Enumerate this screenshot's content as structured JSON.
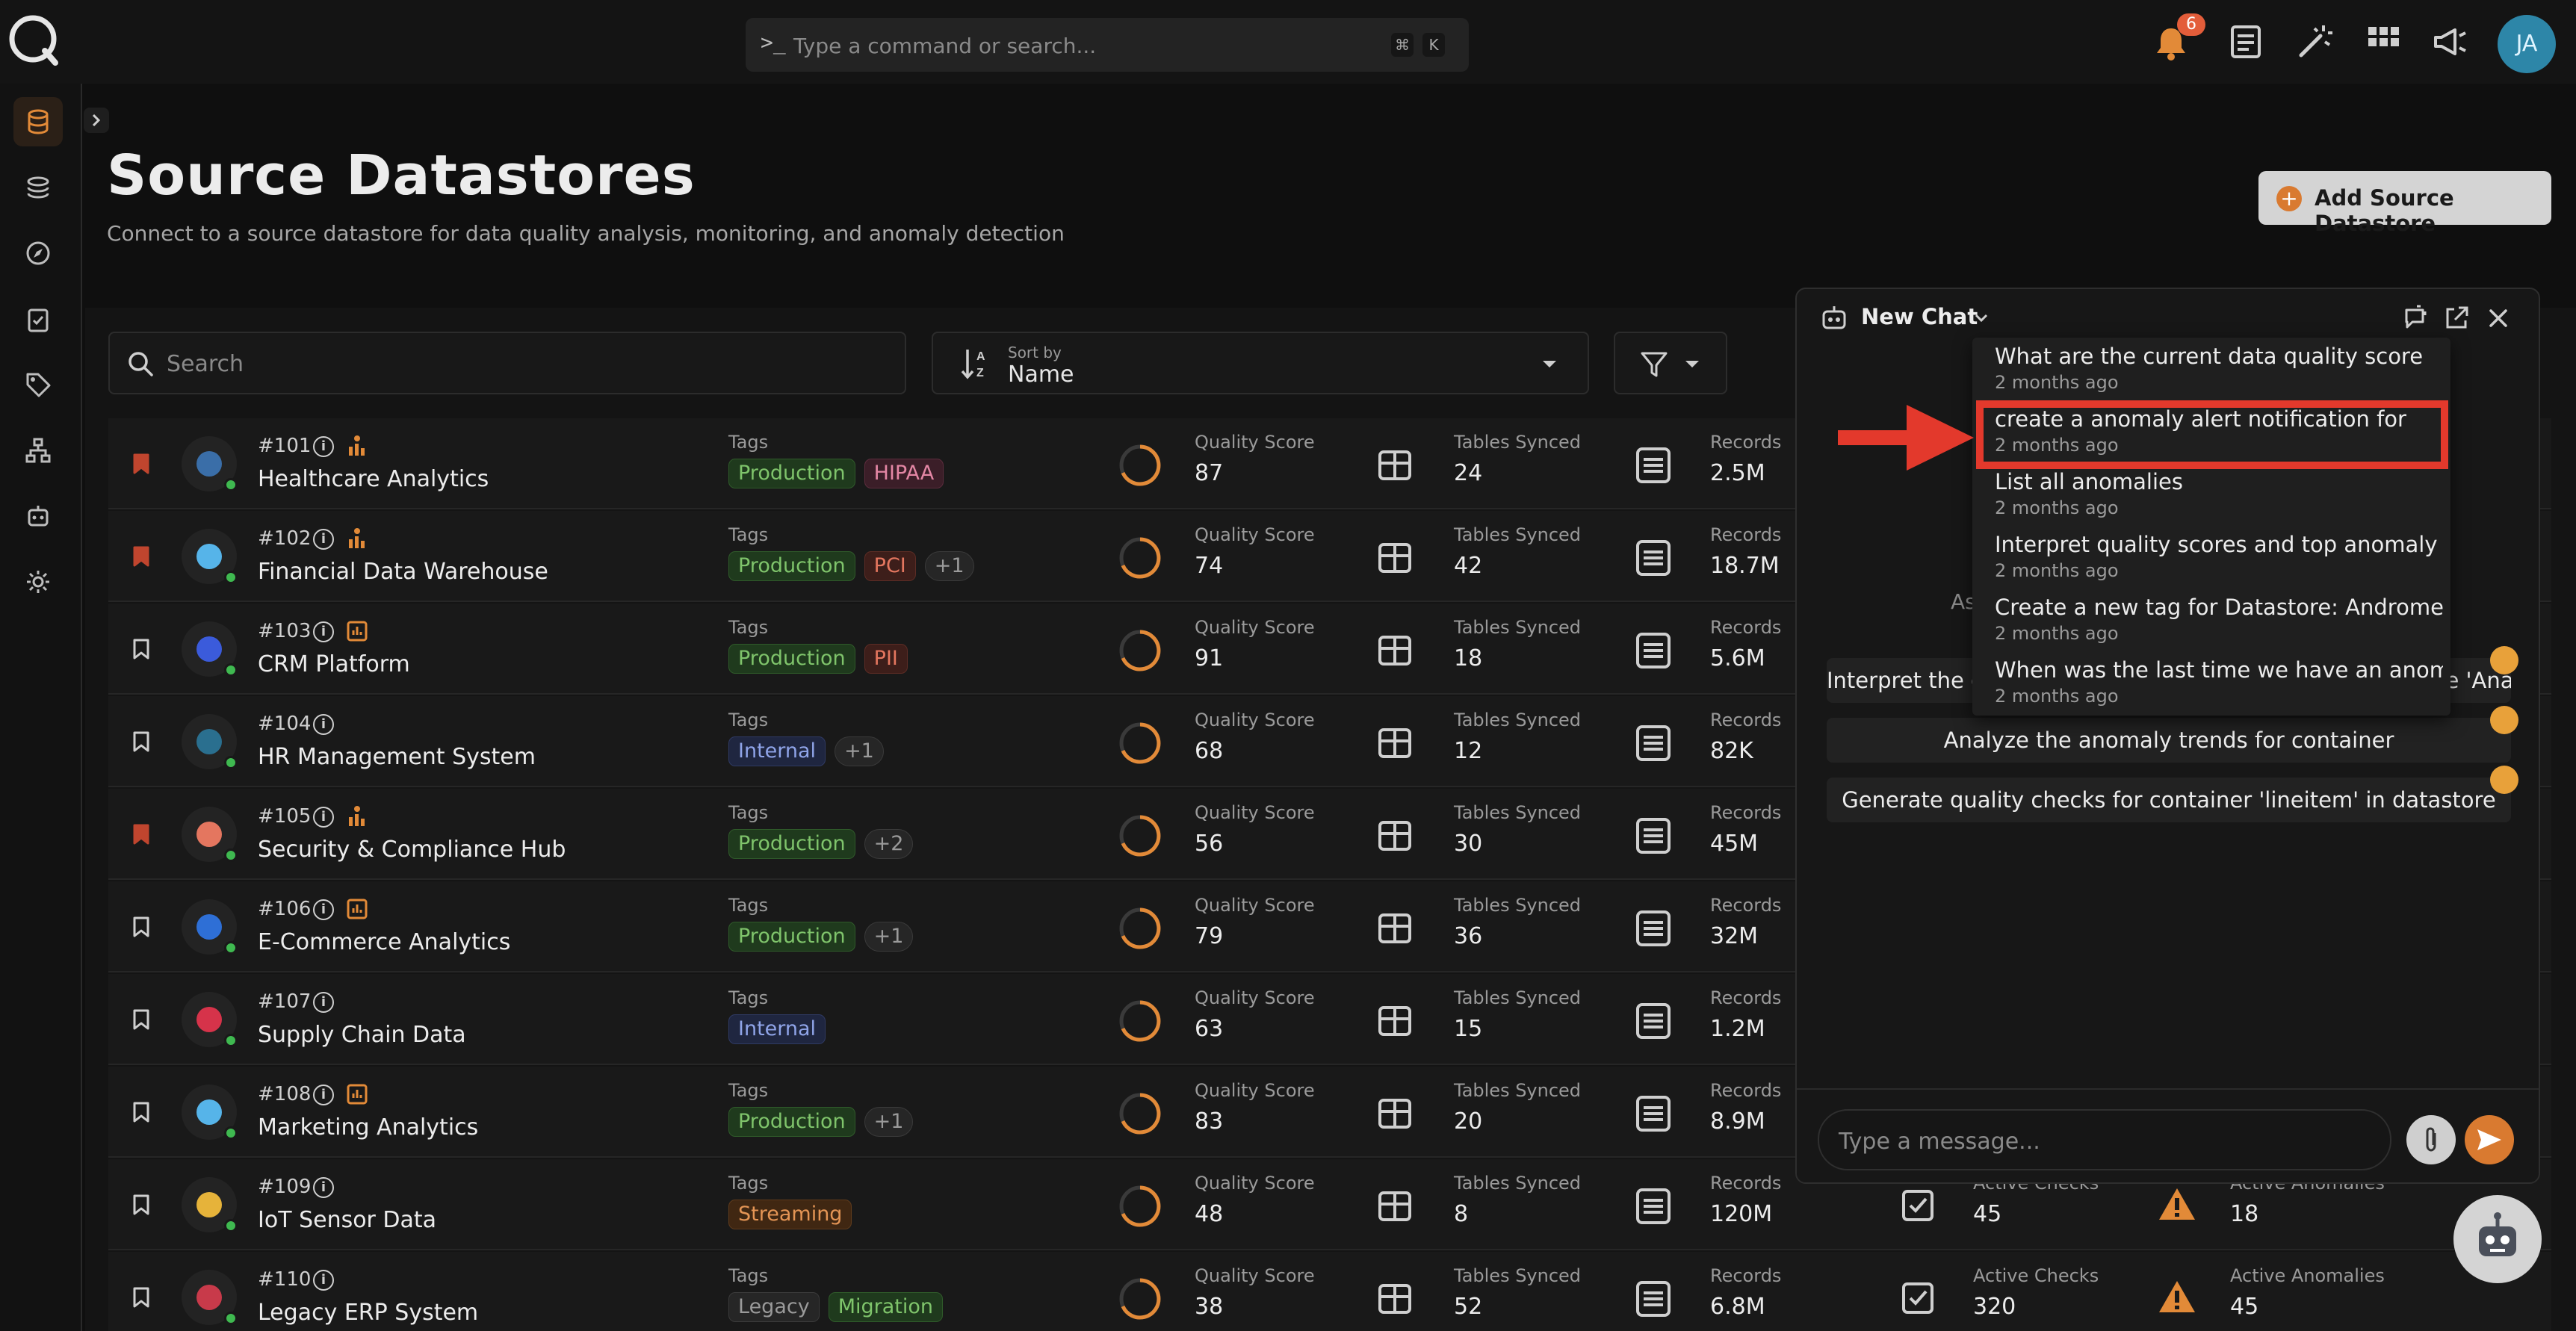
{
  "topbar": {
    "command_prompt": ">_",
    "command_placeholder": "Type a command or search...",
    "shortcut_keys": [
      "⌘",
      "K"
    ],
    "notification_count": "6",
    "avatar_initials": "JA"
  },
  "page": {
    "title": "Source Datastores",
    "subtitle": "Connect to a source datastore for data quality analysis, monitoring, and anomaly detection",
    "add_button": "Add Source Datastore"
  },
  "filters": {
    "search_placeholder": "Search",
    "sort_caption": "Sort by",
    "sort_value": "Name"
  },
  "labels": {
    "tags": "Tags",
    "quality_score": "Quality Score",
    "tables_synced": "Tables Synced",
    "records": "Records",
    "active_checks": "Active Checks",
    "active_anomalies": "Active Anomalies"
  },
  "datastores": [
    {
      "id": "#101",
      "name": "Healthcare Analytics",
      "tags": [
        {
          "t": "Production",
          "c": "green"
        },
        {
          "t": "HIPAA",
          "c": "pink"
        }
      ],
      "quality": "87",
      "tables": "24",
      "records": "2.5M",
      "bookmarked": true
    },
    {
      "id": "#102",
      "name": "Financial Data Warehouse",
      "tags": [
        {
          "t": "Production",
          "c": "green"
        },
        {
          "t": "PCI",
          "c": "red"
        },
        {
          "t": "+1",
          "c": "grey"
        }
      ],
      "quality": "74",
      "tables": "42",
      "records": "18.7M",
      "bookmarked": true
    },
    {
      "id": "#103",
      "name": "CRM Platform",
      "tags": [
        {
          "t": "Production",
          "c": "green"
        },
        {
          "t": "PII",
          "c": "red"
        }
      ],
      "quality": "91",
      "tables": "18",
      "records": "5.6M",
      "bookmarked": false
    },
    {
      "id": "#104",
      "name": "HR Management System",
      "tags": [
        {
          "t": "Internal",
          "c": "blue"
        },
        {
          "t": "+1",
          "c": "grey"
        }
      ],
      "quality": "68",
      "tables": "12",
      "records": "82K",
      "bookmarked": false
    },
    {
      "id": "#105",
      "name": "Security & Compliance Hub",
      "tags": [
        {
          "t": "Production",
          "c": "green"
        },
        {
          "t": "+2",
          "c": "grey"
        }
      ],
      "quality": "56",
      "tables": "30",
      "records": "45M",
      "bookmarked": true
    },
    {
      "id": "#106",
      "name": "E-Commerce Analytics",
      "tags": [
        {
          "t": "Production",
          "c": "green"
        },
        {
          "t": "+1",
          "c": "grey"
        }
      ],
      "quality": "79",
      "tables": "36",
      "records": "32M",
      "bookmarked": false
    },
    {
      "id": "#107",
      "name": "Supply Chain Data",
      "tags": [
        {
          "t": "Internal",
          "c": "blue"
        }
      ],
      "quality": "63",
      "tables": "15",
      "records": "1.2M",
      "bookmarked": false
    },
    {
      "id": "#108",
      "name": "Marketing Analytics",
      "tags": [
        {
          "t": "Production",
          "c": "green"
        },
        {
          "t": "+1",
          "c": "grey"
        }
      ],
      "quality": "83",
      "tables": "20",
      "records": "8.9M",
      "bookmarked": false
    },
    {
      "id": "#109",
      "name": "IoT Sensor Data",
      "tags": [
        {
          "t": "Streaming",
          "c": "orange"
        }
      ],
      "quality": "48",
      "tables": "8",
      "records": "120M",
      "checks": "45",
      "anomalies": "18",
      "bookmarked": false
    },
    {
      "id": "#110",
      "name": "Legacy ERP System",
      "tags": [
        {
          "t": "Legacy",
          "c": "grey2"
        },
        {
          "t": "Migration",
          "c": "green"
        }
      ],
      "quality": "38",
      "tables": "52",
      "records": "6.8M",
      "checks": "320",
      "anomalies": "45",
      "bookmarked": false
    }
  ],
  "chat": {
    "title": "New Chat",
    "ask_partial": "As",
    "suggestions": [
      "Interpret the quality scores and top anomaly for datastore 'Analytics' in",
      "Analyze the anomaly trends for container",
      "Generate quality checks for container 'lineitem' in datastore"
    ],
    "history": [
      {
        "title": "What are the current data quality score",
        "time": "2 months ago"
      },
      {
        "title": "create a anomaly alert notification for",
        "time": "2 months ago"
      },
      {
        "title": "List all anomalies",
        "time": "2 months ago"
      },
      {
        "title": "Interpret quality scores and top anomaly",
        "time": "2 months ago"
      },
      {
        "title": "Create a new tag for Datastore: Andromed",
        "time": "2 months ago"
      },
      {
        "title": "When was the last time we have an anomal",
        "time": "2 months ago"
      }
    ],
    "input_placeholder": "Type a message..."
  }
}
